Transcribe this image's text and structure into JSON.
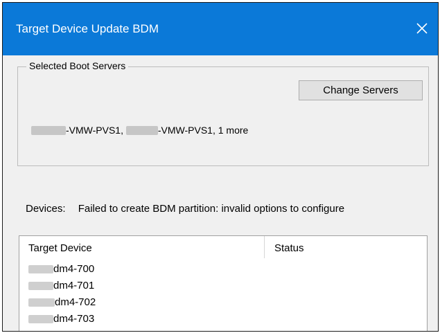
{
  "window": {
    "title": "Target Device Update BDM",
    "close_icon": "close-icon"
  },
  "boot_servers": {
    "legend": "Selected Boot Servers",
    "change_button": "Change Servers",
    "server_1_suffix": "-VMW-PVS1, ",
    "server_2_suffix": "-VMW-PVS1, 1 more"
  },
  "devices": {
    "label": "Devices:",
    "message": "Failed to create BDM partition: invalid options to configure"
  },
  "device_list": {
    "columns": [
      "Target Device",
      "Status"
    ],
    "rows": [
      {
        "device_suffix": "dm4-700",
        "status": ""
      },
      {
        "device_suffix": "dm4-701",
        "status": ""
      },
      {
        "device_suffix": "dm4-702",
        "status": ""
      },
      {
        "device_suffix": "dm4-703",
        "status": ""
      }
    ]
  },
  "colors": {
    "titlebar": "#0b79d8",
    "window_bg": "#f0f0f0",
    "button_bg": "#e1e1e1"
  }
}
